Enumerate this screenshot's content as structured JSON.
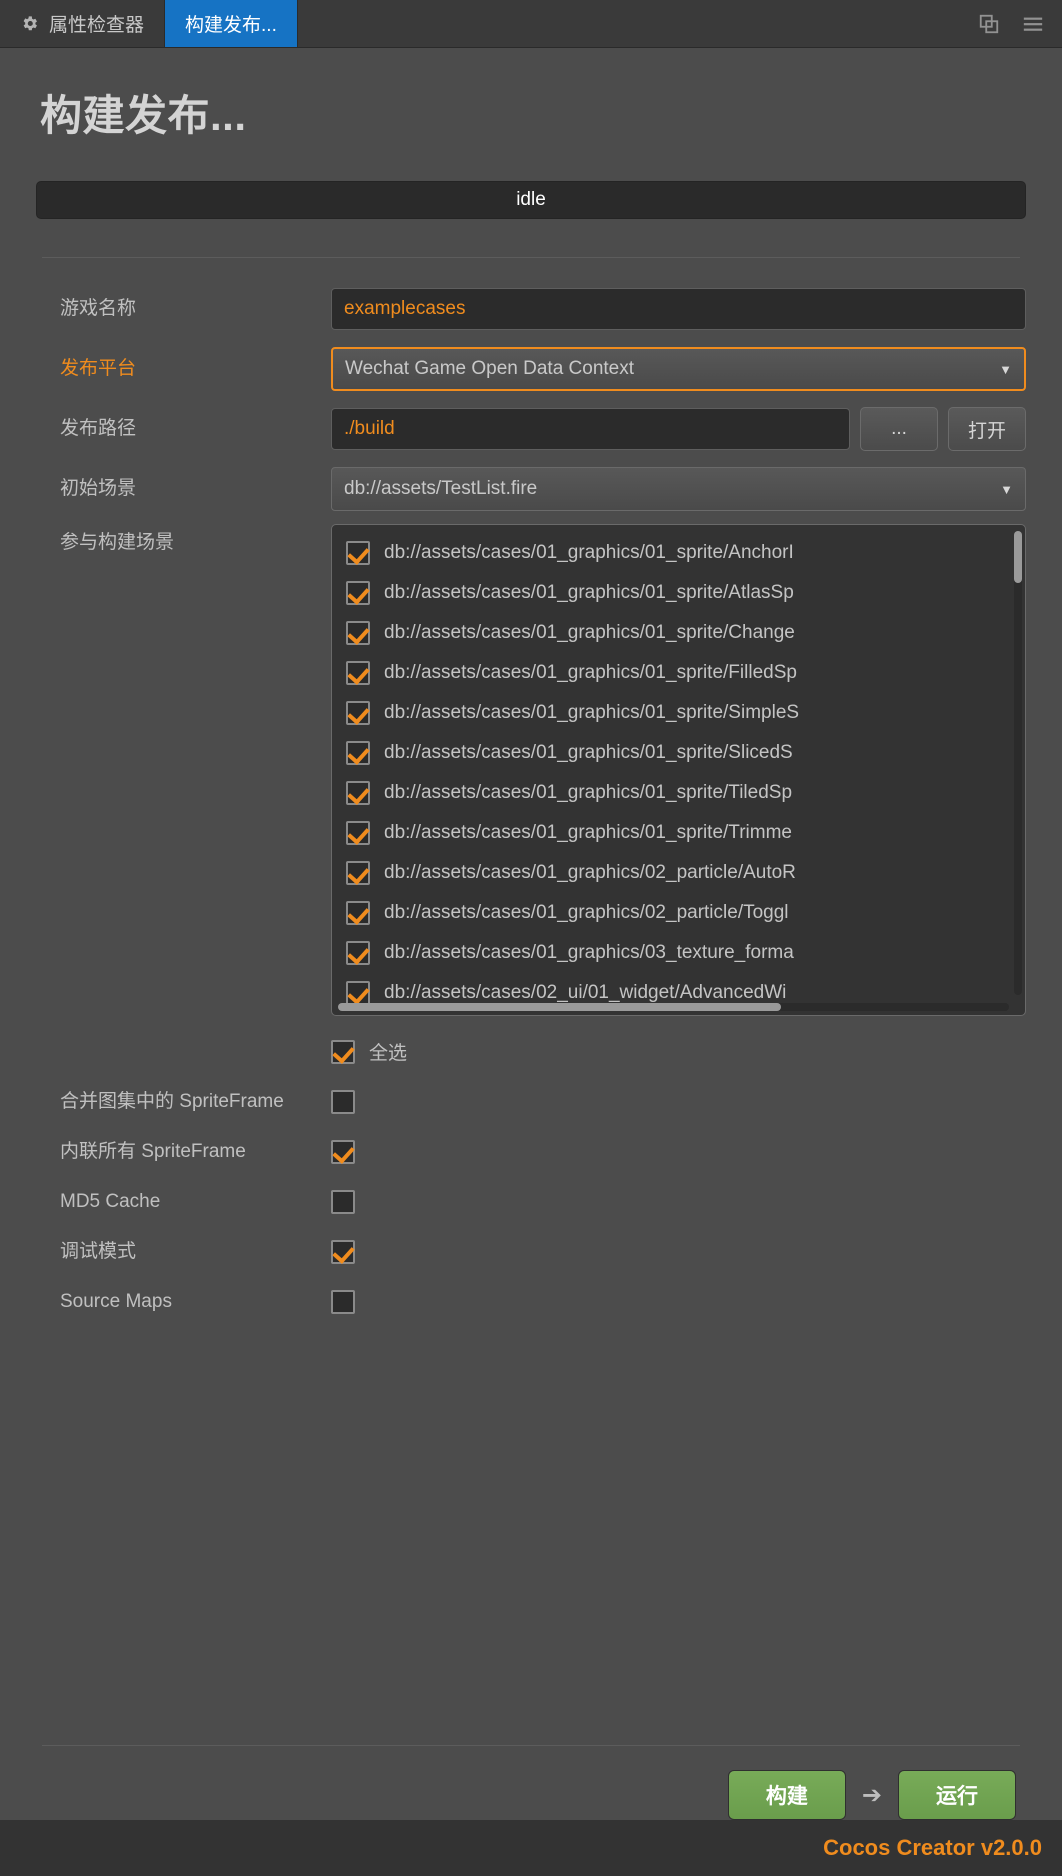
{
  "tabbar": {
    "tabs": [
      {
        "label": "属性检查器",
        "icon": "gear-icon",
        "active": false
      },
      {
        "label": "构建发布...",
        "icon": "",
        "active": true
      }
    ],
    "icons": [
      {
        "name": "popout-panel-icon"
      },
      {
        "name": "hamburger-menu-icon"
      }
    ]
  },
  "page": {
    "title": "构建发布...",
    "progress_status": "idle"
  },
  "form": {
    "game_name": {
      "label": "游戏名称",
      "value": "examplecases",
      "placeholder": ""
    },
    "platform": {
      "label": "发布平台",
      "value": "Wechat Game Open Data Context",
      "caret": "▼",
      "modified": true
    },
    "build_path": {
      "label": "发布路径",
      "value": "./build",
      "browse_label": "...",
      "open_label": "打开"
    },
    "start_scene": {
      "label": "初始场景",
      "value": "db://assets/TestList.fire",
      "caret": "▼"
    },
    "scenes": {
      "label": "参与构建场景",
      "items": [
        {
          "path": "db://assets/cases/01_graphics/01_sprite/AnchorI",
          "checked": true
        },
        {
          "path": "db://assets/cases/01_graphics/01_sprite/AtlasSp",
          "checked": true
        },
        {
          "path": "db://assets/cases/01_graphics/01_sprite/Change",
          "checked": true
        },
        {
          "path": "db://assets/cases/01_graphics/01_sprite/FilledSp",
          "checked": true
        },
        {
          "path": "db://assets/cases/01_graphics/01_sprite/SimpleS",
          "checked": true
        },
        {
          "path": "db://assets/cases/01_graphics/01_sprite/SlicedS",
          "checked": true
        },
        {
          "path": "db://assets/cases/01_graphics/01_sprite/TiledSp",
          "checked": true
        },
        {
          "path": "db://assets/cases/01_graphics/01_sprite/Trimme",
          "checked": true
        },
        {
          "path": "db://assets/cases/01_graphics/02_particle/AutoR",
          "checked": true
        },
        {
          "path": "db://assets/cases/01_graphics/02_particle/Toggl",
          "checked": true
        },
        {
          "path": "db://assets/cases/01_graphics/03_texture_forma",
          "checked": true
        },
        {
          "path": "db://assets/cases/02_ui/01_widget/AdvancedWi",
          "checked": true
        }
      ],
      "select_all": {
        "label": "全选",
        "checked": true
      }
    },
    "options": [
      {
        "label": "合并图集中的 SpriteFrame",
        "checked": false
      },
      {
        "label": "内联所有 SpriteFrame",
        "checked": true
      },
      {
        "label": "MD5 Cache",
        "checked": false
      },
      {
        "label": "调试模式",
        "checked": true
      },
      {
        "label": "Source Maps",
        "checked": false
      }
    ]
  },
  "actions": {
    "build_label": "构建",
    "arrow": "➔",
    "run_label": "运行"
  },
  "statusbar": {
    "brand": "Cocos Creator v2.0.0"
  },
  "colors": {
    "accent_orange": "#f08c1e",
    "tab_active_blue": "#1673c4",
    "button_green": "#6a9d4c",
    "panel_bg": "#4c4c4c",
    "input_bg": "#2b2b2b"
  }
}
